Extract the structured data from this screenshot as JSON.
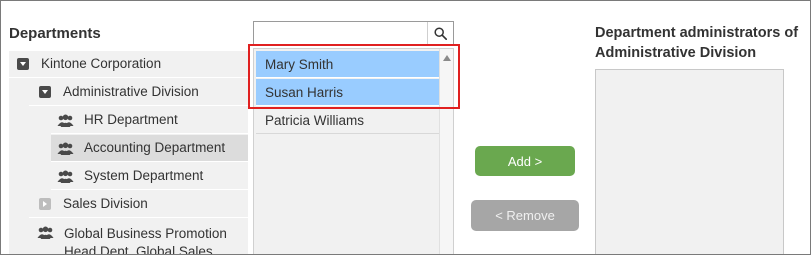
{
  "departments": {
    "title": "Departments",
    "tree": [
      {
        "label": "Kintone Corporation",
        "icon": "expanded"
      },
      {
        "label": "Administrative Division",
        "icon": "expanded"
      },
      {
        "label": "HR Department",
        "icon": "group"
      },
      {
        "label": "Accounting Department",
        "icon": "group",
        "selected": true
      },
      {
        "label": "System Department",
        "icon": "group"
      },
      {
        "label": "Sales Division",
        "icon": "collapsed"
      },
      {
        "label": "Global Business Promotion Head Dept. Global Sales",
        "icon": "group"
      }
    ]
  },
  "search": {
    "value": "",
    "placeholder": ""
  },
  "users": [
    {
      "name": "Mary Smith",
      "selected": true
    },
    {
      "name": "Susan Harris",
      "selected": true
    },
    {
      "name": "Patricia Williams",
      "selected": false
    }
  ],
  "actions": {
    "add_label": "Add >",
    "remove_label": "< Remove"
  },
  "admins": {
    "title": "Department administrators of Administrative Division"
  },
  "colors": {
    "selection": "#99ccff",
    "highlight_border": "#e02020",
    "add_button": "#6aa84f",
    "remove_button": "#a6a6a6"
  }
}
